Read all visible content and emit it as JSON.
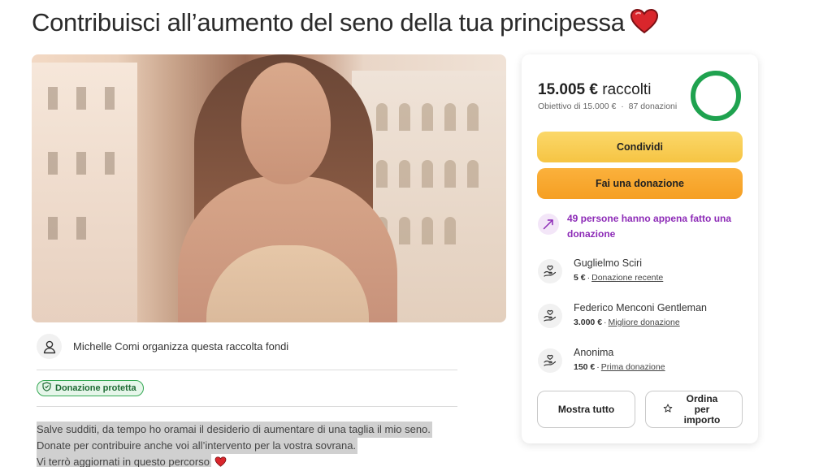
{
  "page": {
    "title": "Contribuisci all’aumento del seno della tua principessa",
    "accent_heart_color": "#d9262c"
  },
  "organizer": {
    "text": "Michelle Comi organizza questa raccolta fondi"
  },
  "badge": {
    "label": "Donazione protetta"
  },
  "story": {
    "lines": [
      "Salve sudditi, da tempo ho oramai il desiderio di aumentare di una taglia il mio seno.",
      "Donate per contribuire anche voi all’intervento per la vostra sovrana.",
      "Vi terrò aggiornati in questo percorso"
    ]
  },
  "donation_card": {
    "amount_raised": "15.005 €",
    "raised_suffix": "raccolti",
    "goal_text": "Obiettivo di 15.000 €",
    "donations_count": "87 donazioni",
    "progress_fraction": 1.0,
    "progress_color": "#1fa24f",
    "share_label": "Condividi",
    "donate_label": "Fai una donazione",
    "trend_text": "49 persone hanno appena fatto una donazione",
    "trend_color": "#8d2bb7",
    "donors": [
      {
        "name": "Guglielmo Sciri",
        "amount": "5 €",
        "tag": "Donazione recente"
      },
      {
        "name": "Federico Menconi Gentleman",
        "amount": "3.000 €",
        "tag": "Migliore donazione"
      },
      {
        "name": "Anonima",
        "amount": "150 €",
        "tag": "Prima donazione"
      }
    ],
    "show_all_label": "Mostra tutto",
    "sort_label": "Ordina per importo"
  },
  "icons": {
    "organizer": "user-icon",
    "badge": "shield-icon",
    "trend": "trending-up-icon",
    "donor": "donation-hands-icon",
    "sort": "star-icon",
    "heart": "heart-icon"
  }
}
